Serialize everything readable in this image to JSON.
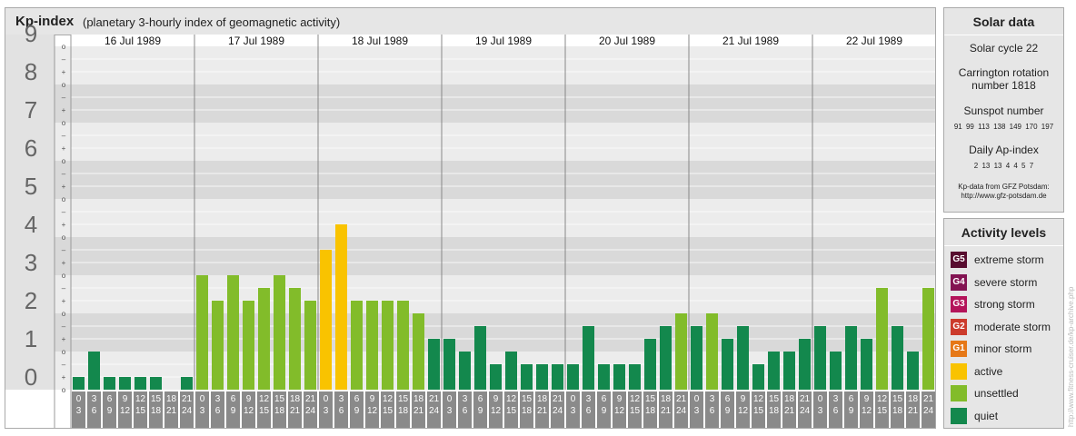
{
  "header": {
    "title": "Kp-index",
    "subtitle": "(planetary 3-hourly index of geomagnetic activity)"
  },
  "colors": {
    "quiet": "#13884d",
    "unsettled": "#82bc2a",
    "active": "#f9c300",
    "minor": "#e67817",
    "moderate": "#cc3b2c",
    "strong": "#b4145a",
    "severe": "#831352",
    "extreme": "#580d2f"
  },
  "chart_data": {
    "type": "bar",
    "title": "Kp-index",
    "ylim": [
      0,
      9
    ],
    "y_ticks": [
      "0",
      "1",
      "2",
      "3",
      "4",
      "5",
      "6",
      "7",
      "8",
      "9"
    ],
    "minor_tick_labels": [
      "o",
      "+",
      "–"
    ],
    "days": [
      "16 Jul 1989",
      "17 Jul 1989",
      "18 Jul 1989",
      "19 Jul 1989",
      "20 Jul 1989",
      "21 Jul 1989",
      "22 Jul 1989"
    ],
    "interval_labels": [
      [
        "0",
        "3"
      ],
      [
        "3",
        "6"
      ],
      [
        "6",
        "9"
      ],
      [
        "9",
        "12"
      ],
      [
        "12",
        "15"
      ],
      [
        "15",
        "18"
      ],
      [
        "18",
        "21"
      ],
      [
        "21",
        "24"
      ]
    ],
    "values": [
      0.333,
      1.0,
      0.333,
      0.333,
      0.333,
      0.333,
      0,
      0.333,
      3.0,
      2.333,
      3.0,
      2.333,
      2.667,
      3.0,
      2.667,
      2.333,
      3.667,
      4.333,
      2.333,
      2.333,
      2.333,
      2.333,
      2.0,
      1.333,
      1.333,
      1.0,
      1.667,
      0.667,
      1.0,
      0.667,
      0.667,
      0.667,
      0.667,
      1.667,
      0.667,
      0.667,
      0.667,
      1.333,
      1.667,
      2.0,
      1.667,
      2.0,
      1.333,
      1.667,
      0.667,
      1.0,
      1.0,
      1.333,
      1.667,
      1.0,
      1.667,
      1.333,
      2.667,
      1.667,
      1.0,
      2.667
    ],
    "legend": [
      "extreme storm",
      "severe storm",
      "strong storm",
      "moderate storm",
      "minor storm",
      "active",
      "unsettled",
      "quiet"
    ]
  },
  "solar": {
    "title": "Solar data",
    "cycle": "Solar cycle 22",
    "carrington_1": "Carrington rotation",
    "carrington_2": "number 1818",
    "sunspot_label": "Sunspot number",
    "sunspot_values": "91 99 113 138 149 170 197",
    "ap_label": "Daily Ap-index",
    "ap_values": "2 13 13 4 4 5 7",
    "credit_1": "Kp-data from GFZ Potsdam:",
    "credit_2": "http://www.gfz-potsdam.de"
  },
  "activity": {
    "title": "Activity levels",
    "items": [
      {
        "badge": "G5",
        "label": "extreme storm",
        "color": "#580d2f"
      },
      {
        "badge": "G4",
        "label": "severe storm",
        "color": "#831352"
      },
      {
        "badge": "G3",
        "label": "strong storm",
        "color": "#b4145a"
      },
      {
        "badge": "G2",
        "label": "moderate storm",
        "color": "#cc3b2c"
      },
      {
        "badge": "G1",
        "label": "minor storm",
        "color": "#e67817"
      },
      {
        "badge": "",
        "label": "active",
        "color": "#f9c300"
      },
      {
        "badge": "",
        "label": "unsettled",
        "color": "#82bc2a"
      },
      {
        "badge": "",
        "label": "quiet",
        "color": "#13884d"
      }
    ]
  },
  "watermark": "http://www.fitness-cruiser.de/kp-archive.php"
}
